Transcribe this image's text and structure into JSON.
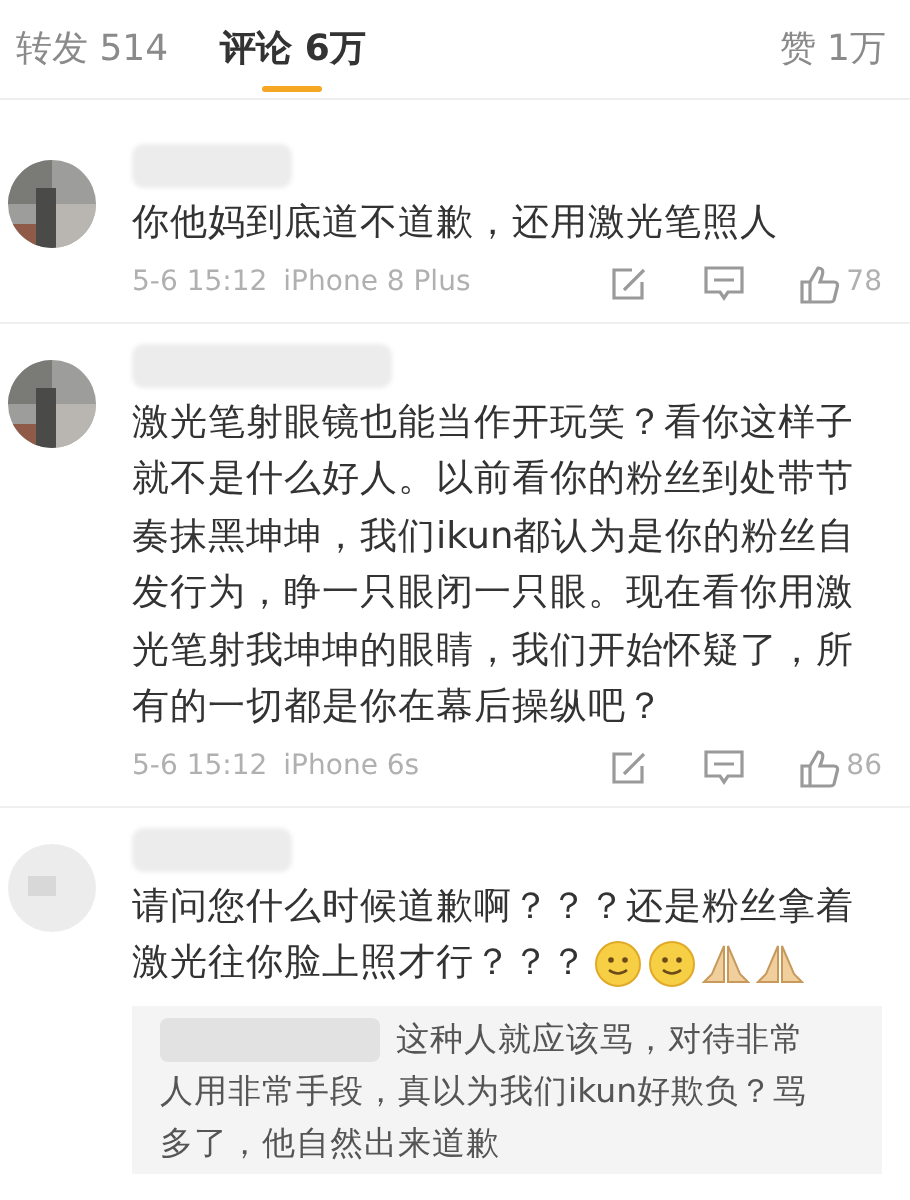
{
  "tabs": [
    {
      "label": "转发 514",
      "selected": false
    },
    {
      "label": "评论 6万",
      "selected": true
    },
    {
      "label": "赞 1万",
      "selected": false
    }
  ],
  "comments": [
    {
      "text": "你他妈到底道不道歉，还用激光笔照人",
      "time": "5-6 15:12",
      "device": "iPhone 8 Plus",
      "likes": "78"
    },
    {
      "text": "激光笔射眼镜也能当作开玩笑？看你这样子就不是什么好人。以前看你的粉丝到处带节奏抹黑坤坤，我们ikun都认为是你的粉丝自发行为，睁一只眼闭一只眼。现在看你用激光笔射我坤坤的眼睛，我们开始怀疑了，所有的一切都是你在幕后操纵吧？",
      "time": "5-6 15:12",
      "device": "iPhone 6s",
      "likes": "86"
    },
    {
      "lines": [
        "请问您什么时候道歉啊？？？还是粉丝拿着",
        "激光往你脸上照才行？？？"
      ],
      "emojis": [
        {
          "kind": "smile"
        },
        {
          "kind": "smile"
        },
        {
          "kind": "pray"
        },
        {
          "kind": "pray"
        }
      ],
      "reply": {
        "lines": [
          "这种人就应该骂，对待非常",
          "人用非常手段，真以为我们ikun好欺负？骂",
          "多了，他自然出来道歉"
        ]
      }
    }
  ]
}
